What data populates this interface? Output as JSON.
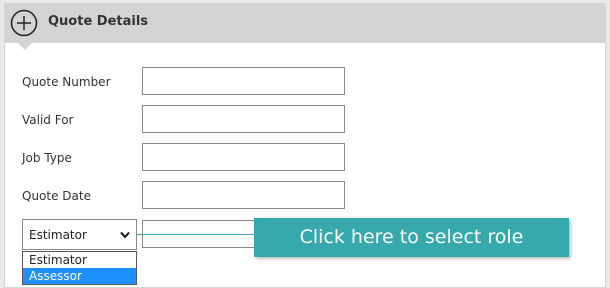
{
  "panel": {
    "title": "Quote Details",
    "header_color": "#d4d4d4",
    "icon": "plus-circle-icon"
  },
  "fields": [
    {
      "label": "Quote Number",
      "value": ""
    },
    {
      "label": "Valid For",
      "value": ""
    },
    {
      "label": "Job Type",
      "value": ""
    },
    {
      "label": "Quote Date",
      "value": ""
    }
  ],
  "role_select": {
    "selected": "Estimator",
    "options": [
      "Estimator",
      "Assessor"
    ],
    "highlighted": "Assessor",
    "highlight_color": "#1e90ff"
  },
  "callout": {
    "text": "Click here to select role",
    "color": "#36a9ad"
  }
}
